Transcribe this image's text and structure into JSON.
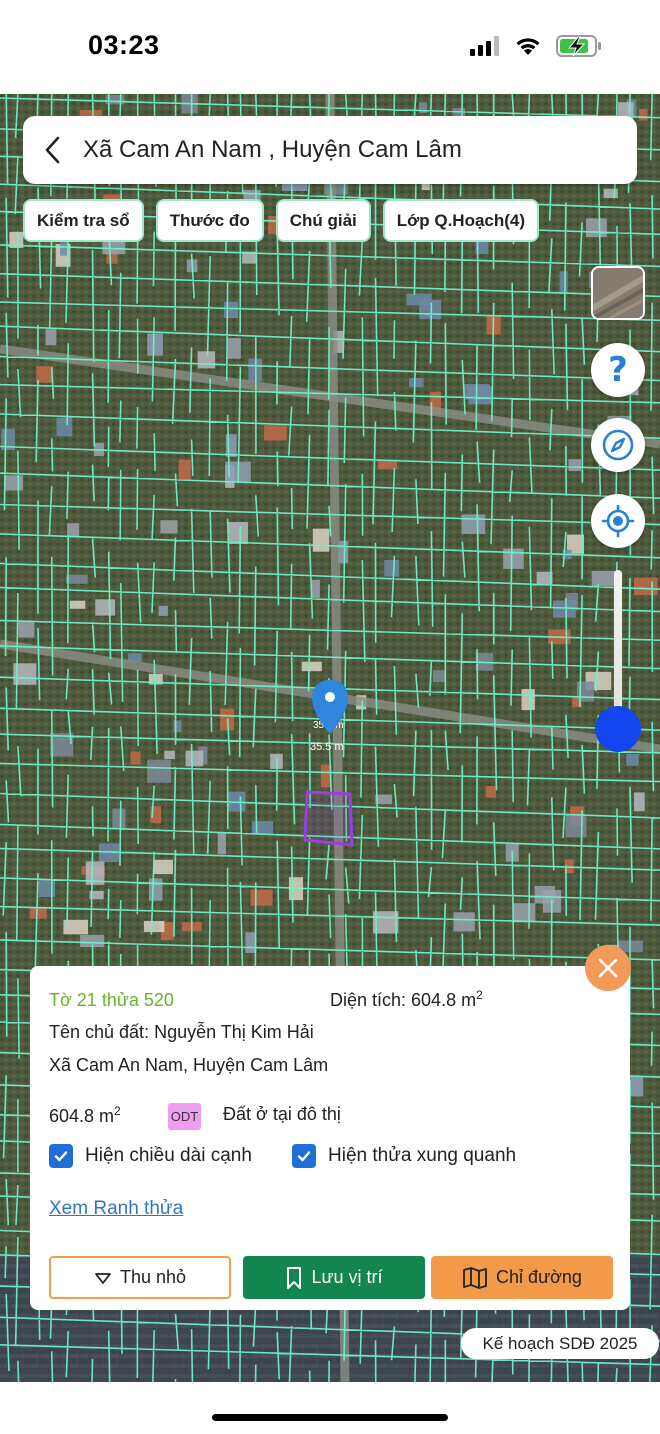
{
  "status_bar": {
    "time": "03:23",
    "icons": [
      "signal-icon",
      "wifi-icon",
      "battery-charging-icon"
    ]
  },
  "header": {
    "back_icon": "chevron-left-icon",
    "title": "Xã Cam An Nam , Huyện Cam Lâm"
  },
  "chips": [
    {
      "label": "Kiểm tra sổ"
    },
    {
      "label": "Thước đo"
    },
    {
      "label": "Chú giải"
    },
    {
      "label": "Lớp Q.Hoạch(4)"
    }
  ],
  "map": {
    "parcel_edge_label_top": "35.5 m",
    "parcel_edge_label_bottom": "35.5 m",
    "boundary_color": "#6ff0c8",
    "parcel_highlight_color": "#9b3fe0",
    "pin_color": "#2f86dc",
    "controls": [
      "layer-thumbnail",
      "help-icon",
      "compass-icon",
      "locate-icon",
      "zoom-slider"
    ]
  },
  "info": {
    "parcel_id": "Tờ 21 thửa 520",
    "area_prefix": "Diện tích: 604.8 m",
    "area_sup": "2",
    "owner": "Tên chủ đất: Nguyễn Thị Kim Hải",
    "address": "Xã Cam An Nam, Huyện Cam Lâm",
    "land_area": "604.8 m",
    "land_area_sup": "2",
    "land_code": "ODT",
    "land_type": "Đất ở tại đô thị",
    "checkbox_edges": "Hiện chiều dài cạnh",
    "checkbox_neighbors": "Hiện thửa xung quanh",
    "view_link": "Xem Ranh thửa",
    "btn_collapse": "Thu nhỏ",
    "btn_save": "Lưu vị trí",
    "btn_route": "Chỉ đường"
  },
  "plan_badge": "Kế hoạch SDĐ 2025",
  "colors": {
    "accent_green": "#69b42e",
    "save_green": "#13864f",
    "route_orange": "#f29a4a",
    "close_orange": "#f29a5a",
    "link_blue": "#2f77c6",
    "zoom_blue": "#1446f0"
  }
}
